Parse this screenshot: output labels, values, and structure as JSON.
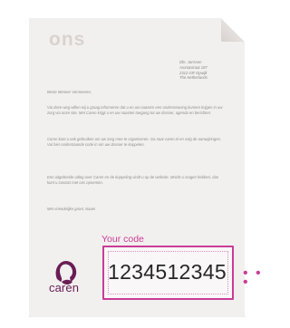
{
  "document": {
    "logo_text": "ons",
    "address_lines": "Dhr. Janssen\nAroniastraat 187\n2312 GR Opwijk\nThe Netherlands",
    "greeting": "Beste Meneer Vermeeren,",
    "paragraph_1": "Via deze weg willen wij u graag informeren dat u en uw naasten een ondersteuning kunnen krijgen in uw zorg via onze site. Met Caren krijgt u en uw naasten toegang tot uw dossier, agenda en berichten.",
    "paragraph_2": "Caren kunt u ook gebruiken om uw zorg mee te organiseren. Ga naar caren.nl en volg de aanwijzingen. Vul hier onderstaande code in om uw dossier te koppelen.",
    "paragraph_3": "Een uitgebreide uitleg over Caren en de koppeling vindt u op de website. Mocht u vragen hebben, dan kunt u contact met ons opnemen.",
    "closing": "Met vriendelijke groet,\nNaam"
  },
  "code_section": {
    "label": "Your code",
    "value": "1234512345"
  },
  "brand": {
    "name": "caren",
    "accent_color": "#c93c96",
    "logo_color": "#6a1d55"
  },
  "icons": {
    "logo": "caren-logo-icon",
    "continuation": "dots-icon"
  }
}
